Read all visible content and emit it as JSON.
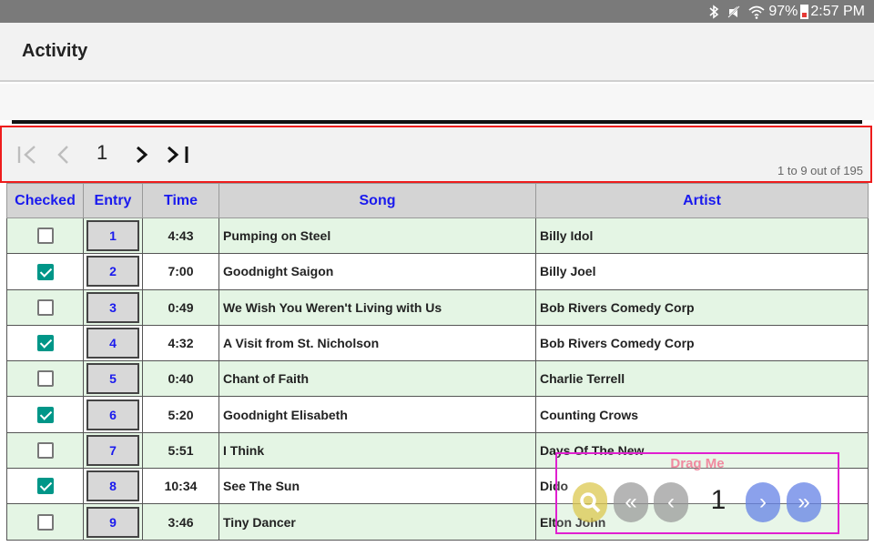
{
  "status_bar": {
    "bluetooth_icon": "bluetooth-icon",
    "mute_icon": "vibrate-off-icon",
    "wifi_icon": "wifi-icon",
    "battery": "97%",
    "time": "2:57 PM"
  },
  "app_bar": {
    "title": "Activity"
  },
  "pager": {
    "first_glyph": "|<",
    "prev_glyph": "<",
    "page": "1",
    "next_glyph": ">",
    "last_glyph": ">|",
    "count": "1 to 9 out of 195"
  },
  "table": {
    "headers": [
      "Checked",
      "Entry",
      "Time",
      "Song",
      "Artist"
    ],
    "rows": [
      {
        "checked": false,
        "entry": "1",
        "time": "4:43",
        "song": "Pumping on Steel",
        "artist": "Billy Idol"
      },
      {
        "checked": true,
        "entry": "2",
        "time": "7:00",
        "song": "Goodnight Saigon",
        "artist": "Billy Joel"
      },
      {
        "checked": false,
        "entry": "3",
        "time": "0:49",
        "song": "We Wish You Weren't Living with Us",
        "artist": "Bob Rivers Comedy Corp"
      },
      {
        "checked": true,
        "entry": "4",
        "time": "4:32",
        "song": "A Visit from St. Nicholson",
        "artist": "Bob Rivers Comedy Corp"
      },
      {
        "checked": false,
        "entry": "5",
        "time": "0:40",
        "song": "Chant of Faith",
        "artist": "Charlie Terrell"
      },
      {
        "checked": true,
        "entry": "6",
        "time": "5:20",
        "song": "Goodnight Elisabeth",
        "artist": "Counting Crows"
      },
      {
        "checked": false,
        "entry": "7",
        "time": "5:51",
        "song": "I Think",
        "artist": "Days Of The New"
      },
      {
        "checked": true,
        "entry": "8",
        "time": "10:34",
        "song": "See The Sun",
        "artist": "Dido"
      },
      {
        "checked": false,
        "entry": "9",
        "time": "3:46",
        "song": "Tiny Dancer",
        "artist": "Elton John"
      }
    ]
  },
  "drag_panel": {
    "label": "Drag Me",
    "page": "1",
    "search_icon": "search-icon",
    "first_glyph": "«",
    "prev_glyph": "‹",
    "next_glyph": "›",
    "last_glyph": "»"
  }
}
